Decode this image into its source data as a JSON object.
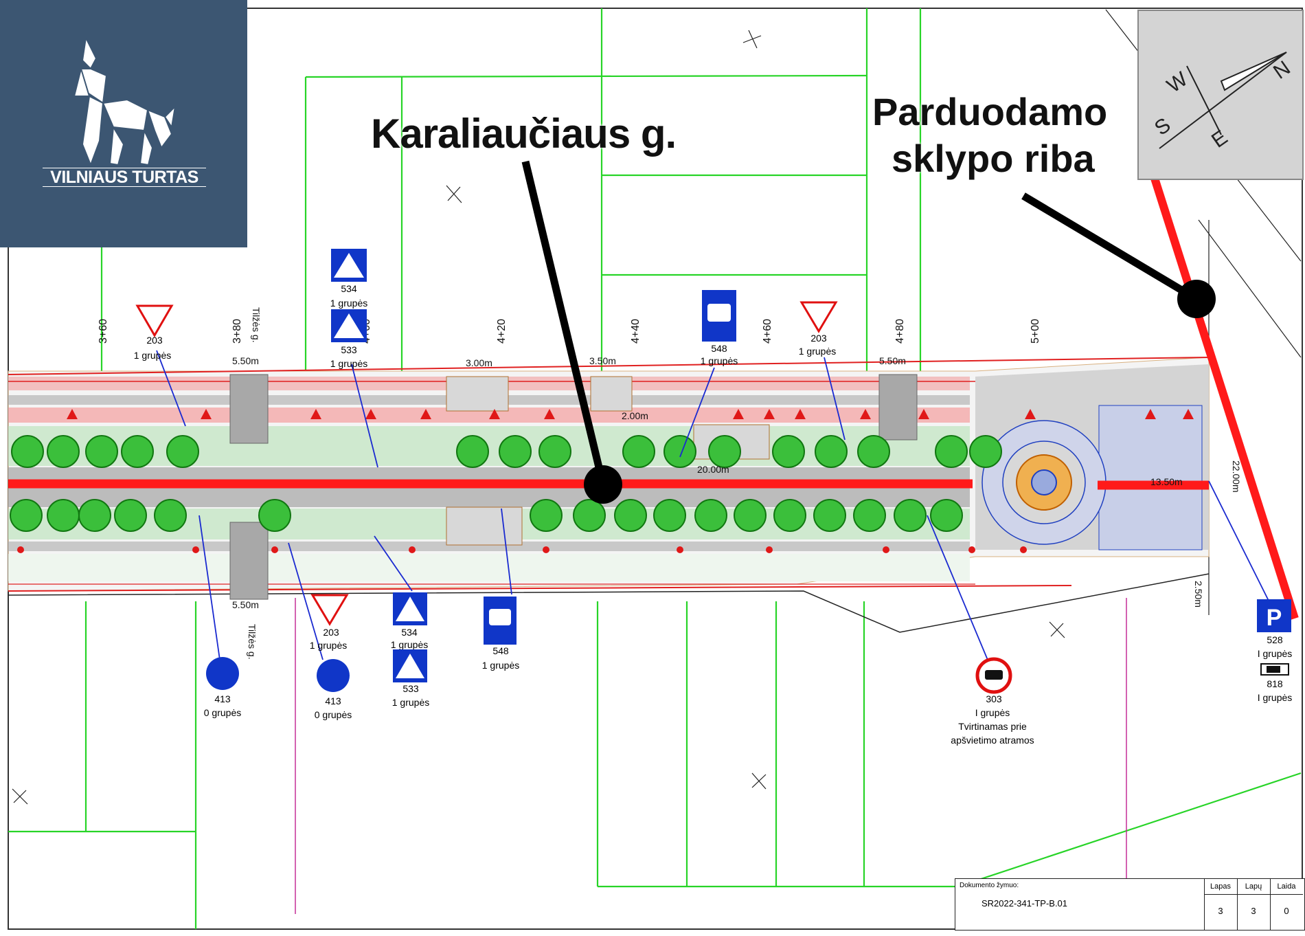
{
  "logo": {
    "text": "VILNIAUS TURTAS"
  },
  "annotations": {
    "street": "Karaliaučiaus g.",
    "boundary_line1": "Parduodamo",
    "boundary_line2": "sklypo riba"
  },
  "compass": {
    "n": "N",
    "s": "S",
    "e": "E",
    "w": "W"
  },
  "chainage": [
    "3+60",
    "3+80",
    "4+00",
    "4+20",
    "4+40",
    "4+60",
    "4+80",
    "5+00"
  ],
  "side_street": "Tilžės g.",
  "dimensions": {
    "d1": "5.50m",
    "d2": "3.00m",
    "d3": "3.50m",
    "d4": "5.50m",
    "d5": "2.00m",
    "d6": "20.00m",
    "d7": "13.50m",
    "d8": "22.00m",
    "d9": "2.50m",
    "d10": "5.50m"
  },
  "signs_top": [
    {
      "code": "534",
      "group": "1 grupės"
    },
    {
      "code": "533",
      "group": "1 grupės"
    },
    {
      "code": "203",
      "group": "1 grupės"
    },
    {
      "code": "548",
      "group": "1 grupės"
    },
    {
      "code": "203",
      "group": "1 grupės"
    }
  ],
  "signs_bottom": [
    {
      "code": "413",
      "group": "0 grupės"
    },
    {
      "code": "413",
      "group": "0 grupės"
    },
    {
      "code": "203",
      "group": "1 grupės"
    },
    {
      "code": "534",
      "group": "1 grupės"
    },
    {
      "code": "533",
      "group": "1 grupės"
    },
    {
      "code": "548",
      "group": "1 grupės"
    },
    {
      "code": "303",
      "group": "I grupės",
      "note1": "Tvirtinamas prie",
      "note2": "apšvietimo atramos"
    },
    {
      "code": "528",
      "group": "I grupės"
    },
    {
      "code": "818",
      "group": "I grupės"
    }
  ],
  "title_block": {
    "doc_label": "Dokumento žymuo:",
    "doc_value": "SR2022-341-TP-B.01",
    "cols": [
      {
        "head": "Lapas",
        "val": "3"
      },
      {
        "head": "Lapų",
        "val": "3"
      },
      {
        "head": "Laida",
        "val": "0"
      }
    ]
  },
  "colors": {
    "logo_bg": "#3c5672",
    "boundary": "#ff1a1a",
    "parcel": "#22dd22",
    "sign_blue": "#1036c8",
    "sign_red": "#e01010"
  }
}
